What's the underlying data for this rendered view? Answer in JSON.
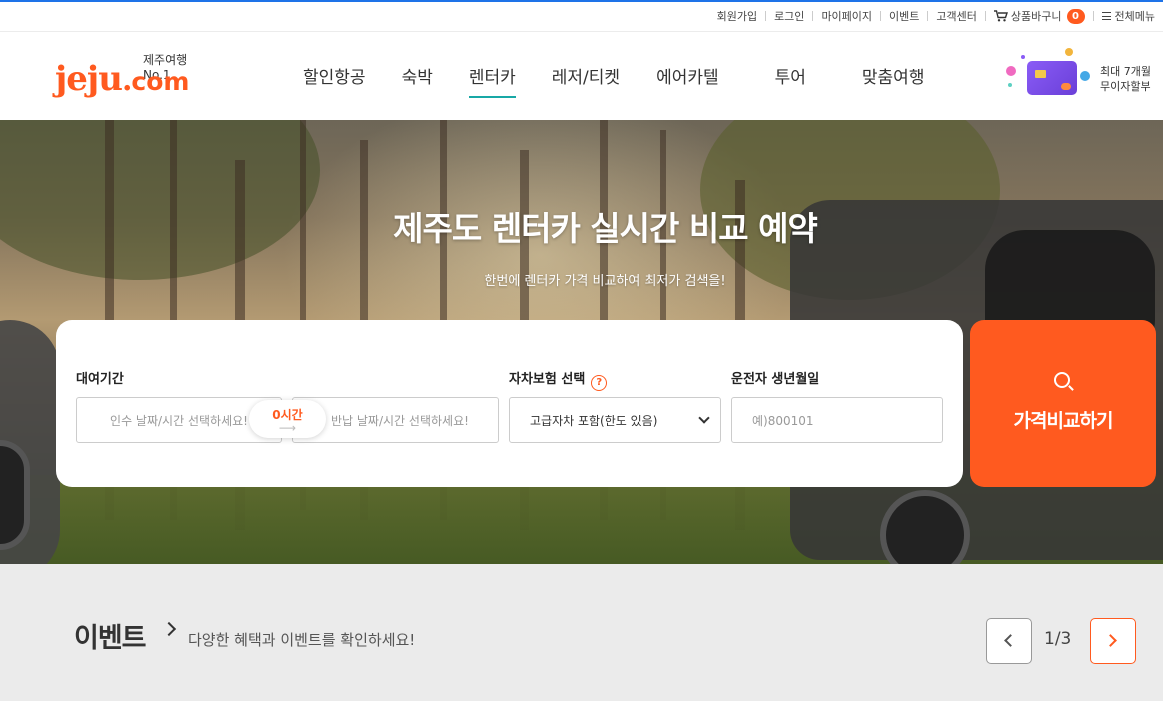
{
  "util_links": {
    "signup": "회원가입",
    "login": "로그인",
    "mypage": "마이페이지",
    "event": "이벤트",
    "support": "고객센터",
    "cart": "상품바구니",
    "cart_count": "0",
    "all_menu": "전체메뉴"
  },
  "logo": {
    "tagline": "제주여행 No.1",
    "main": "jeju",
    "dot": ".",
    "suffix": "com"
  },
  "nav": {
    "items": [
      {
        "label": "할인항공"
      },
      {
        "label": "숙박"
      },
      {
        "label": "렌터카",
        "active": true
      },
      {
        "label": "레저/티켓"
      },
      {
        "label": "에어카텔"
      },
      {
        "label": "투어"
      },
      {
        "label": "맞춤여행"
      }
    ]
  },
  "promo": {
    "line1": "최대 7개월",
    "line2": "무이자할부"
  },
  "hero": {
    "title": "제주도 렌터카 실시간 비교 예약",
    "subtitle": "한번에 렌터카 가격 비교하여 최저가 검색을!"
  },
  "search": {
    "period_label": "대여기간",
    "pickup_placeholder": "인수 날짜/시간 선택하세요!",
    "return_placeholder": "반납 날짜/시간 선택하세요!",
    "hours": "0시간",
    "hours_arrow": "⟶",
    "insurance_label": "자차보험 선택",
    "insurance_help": "?",
    "insurance_value": "고급자차 포함(한도 있음)",
    "birth_label": "운전자 생년월일",
    "birth_placeholder": "예)800101",
    "submit": "가격비교하기"
  },
  "events": {
    "title": "이벤트",
    "subtitle": "다양한 혜택과 이벤트를 확인하세요!",
    "page": "1/3"
  },
  "colors": {
    "accent": "#ff5a1f",
    "nav_active": "#18a8a6",
    "top_accent": "#1e73e8"
  },
  "icons": [
    "cart-icon",
    "menu-icon",
    "search-icon",
    "chevron-down-icon",
    "chevron-left-icon",
    "chevron-right-icon",
    "help-icon"
  ]
}
